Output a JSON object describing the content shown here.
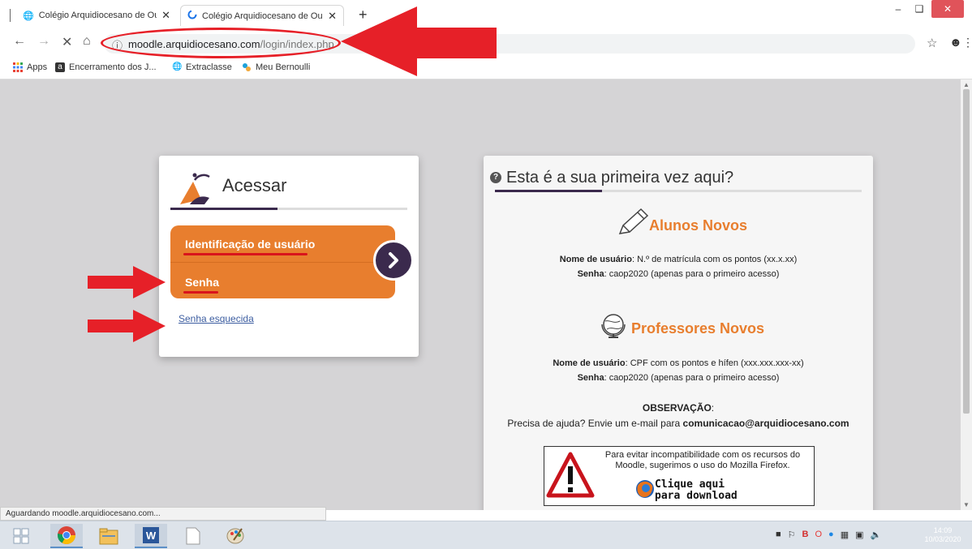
{
  "browser": {
    "tabs": [
      {
        "title": "Colégio Arquidiocesano de Ouro",
        "active": false
      },
      {
        "title": "Colégio Arquidiocesano de Ouro",
        "active": true
      }
    ],
    "new_tab": "+",
    "url_domain": "moodle.arquidiocesano.com",
    "url_path": "/login/index.php",
    "bookmarks": [
      {
        "label": "Apps",
        "icon": "apps-grid-icon"
      },
      {
        "label": "Encerramento dos J...",
        "icon": "bookmark-a-icon"
      },
      {
        "label": "Extraclasse",
        "icon": "globe-icon"
      },
      {
        "label": "Meu Bernoulli",
        "icon": "bernoulli-icon"
      }
    ],
    "status_text": "Aguardando moodle.arquidiocesano.com..."
  },
  "login": {
    "title": "Acessar",
    "username_placeholder": "Identificação de usuário",
    "password_placeholder": "Senha",
    "forgot_link": "Senha esquecida"
  },
  "info": {
    "title": "Esta é a sua primeira vez aqui?",
    "alunos": {
      "title": "Alunos Novos",
      "user_label": "Nome de usuário",
      "user_text": ": N.º de matrícula com os pontos (xx.x.xx)",
      "pass_label": "Senha",
      "pass_text": ": caop2020 (apenas para o primeiro acesso)"
    },
    "professores": {
      "title": "Professores Novos",
      "user_label": "Nome de usuário",
      "user_text": ": CPF com os pontos e hífen (xxx.xxx.xxx-xx)",
      "pass_label": "Senha",
      "pass_text": ": caop2020 (apenas para o primeiro acesso)"
    },
    "obs_title": "OBSERVAÇÃO",
    "obs_colon": ":",
    "obs_text": "Precisa de ajuda? Envie um e-mail para ",
    "obs_email": "comunicacao@arquidiocesano.com",
    "firefox_notice": "Para evitar incompatibilidade com os recursos do Moodle, sugerimos o uso do Mozilla Firefox.",
    "firefox_link_line1": "Clique aqui",
    "firefox_link_line2": "para download"
  },
  "taskbar": {
    "time": "14:09",
    "date": "10/03/2020"
  },
  "colors": {
    "accent_orange": "#e87e2e",
    "accent_purple": "#3b2a4d",
    "annotation_red": "#e62028"
  }
}
